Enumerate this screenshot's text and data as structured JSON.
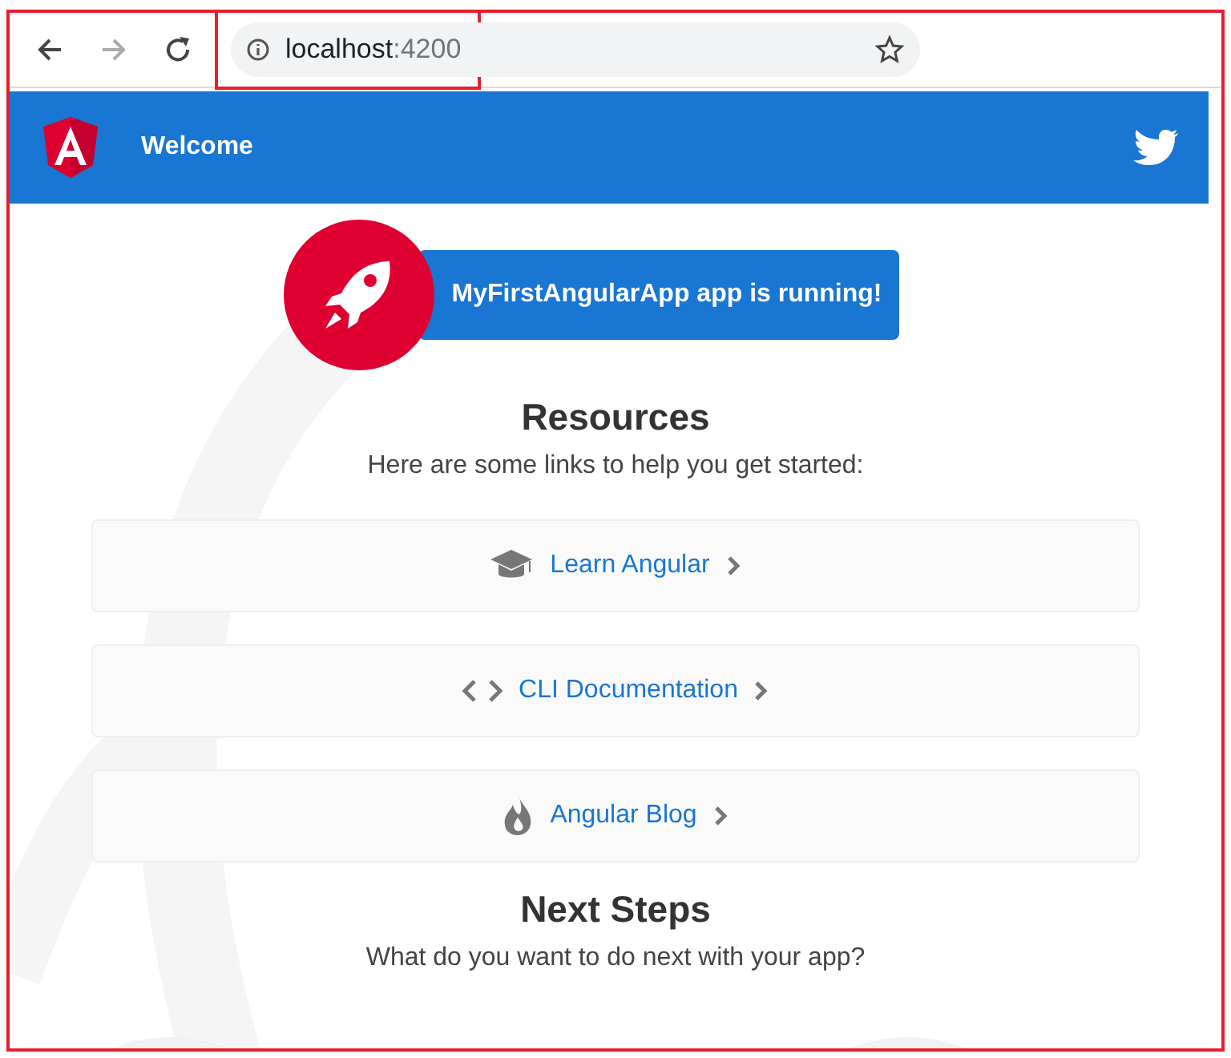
{
  "browser": {
    "url_host": "localhost",
    "url_port": ":4200"
  },
  "toolbar": {
    "title": "Welcome"
  },
  "banner": {
    "text": "MyFirstAngularApp app is running!"
  },
  "resources": {
    "heading": "Resources",
    "subtitle": "Here are some links to help you get started:",
    "links": [
      {
        "kind": "learn",
        "label": "Learn Angular"
      },
      {
        "kind": "cli",
        "label": "CLI Documentation"
      },
      {
        "kind": "blog",
        "label": "Angular Blog"
      }
    ]
  },
  "next_steps": {
    "heading": "Next Steps",
    "subtitle": "What do you want to do next with your app?"
  }
}
